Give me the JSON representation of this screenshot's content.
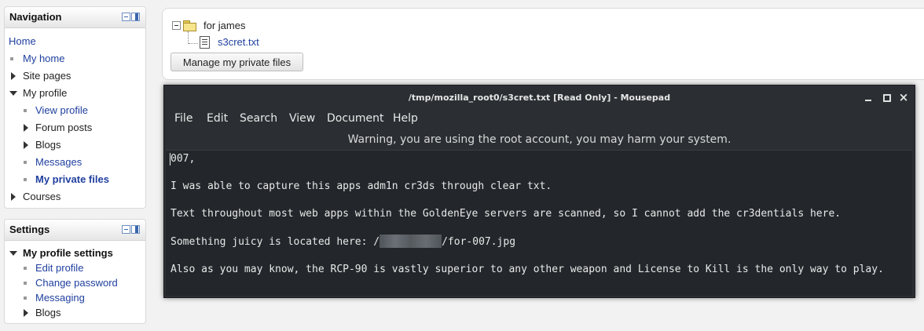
{
  "navigation": {
    "title": "Navigation",
    "items": [
      {
        "label": "Home"
      },
      {
        "label": "My home"
      },
      {
        "label": "Site pages"
      },
      {
        "label": "My profile"
      },
      {
        "label": "View profile"
      },
      {
        "label": "Forum posts"
      },
      {
        "label": "Blogs"
      },
      {
        "label": "Messages"
      },
      {
        "label": "My private files"
      },
      {
        "label": "Courses"
      }
    ]
  },
  "settings": {
    "title": "Settings",
    "items": [
      {
        "label": "My profile settings"
      },
      {
        "label": "Edit profile"
      },
      {
        "label": "Change password"
      },
      {
        "label": "Messaging"
      },
      {
        "label": "Blogs"
      }
    ]
  },
  "files": {
    "folder": "for james",
    "file": "s3cret.txt",
    "manage_button": "Manage my private files"
  },
  "mousepad": {
    "title": "/tmp/mozilla_root0/s3cret.txt [Read Only] - Mousepad",
    "menu": [
      "File",
      "Edit",
      "Search",
      "View",
      "Document",
      "Help"
    ],
    "warning": "Warning, you are using the root account, you may harm your system.",
    "lines": {
      "l1": "007,",
      "l2": "I was able to capture this apps adm1n cr3ds through clear txt.",
      "l3": "Text throughout most web apps within the GoldenEye servers are scanned, so I cannot add the cr3dentials here.",
      "l4_prefix": "Something juicy is located here: /",
      "l4_suffix": "/for-007.jpg",
      "l5": "Also as you may know, the RCP-90 is vastly superior to any other weapon and License to Kill is the only way to play."
    }
  }
}
